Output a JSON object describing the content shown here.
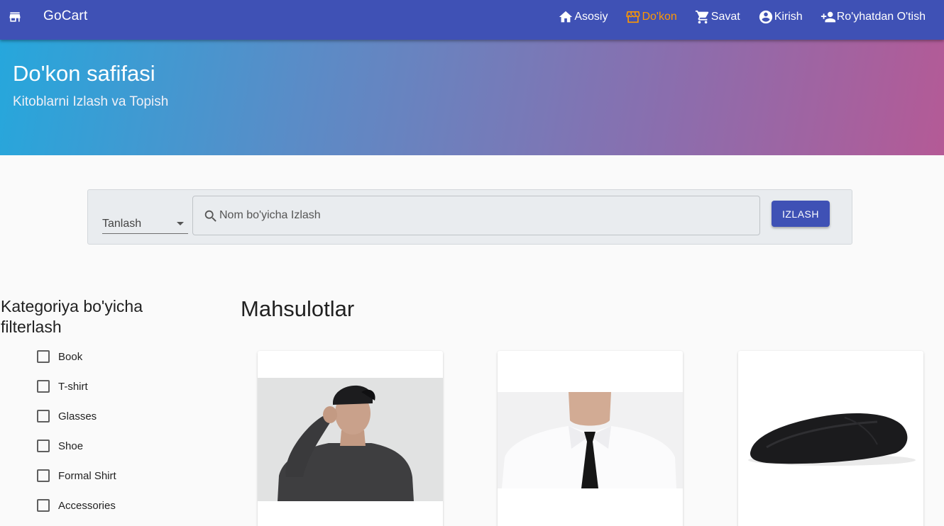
{
  "header": {
    "brand": "GoCart",
    "nav": [
      {
        "label": "Asosiy",
        "icon": "home-icon"
      },
      {
        "label": "Do'kon",
        "icon": "store-icon"
      },
      {
        "label": "Savat",
        "icon": "cart-icon"
      },
      {
        "label": "Kirish",
        "icon": "account-circle-icon"
      },
      {
        "label": "Ro'yhatdan O'tish",
        "icon": "person-add-icon"
      }
    ],
    "active_color": "#ff9800",
    "bar_color": "#3f51b5"
  },
  "hero": {
    "title": "Do'kon safifasi",
    "subtitle": "Kitoblarni Izlash va Topish"
  },
  "search": {
    "select_label": "Tanlash",
    "placeholder": "Nom bo'yicha Izlash",
    "button": "IZLASH"
  },
  "filters": {
    "title": "Kategoriya bo'yicha filterlash",
    "items": [
      {
        "label": "Book",
        "checked": false
      },
      {
        "label": "T-shirt",
        "checked": false
      },
      {
        "label": "Glasses",
        "checked": false
      },
      {
        "label": "Shoe",
        "checked": false
      },
      {
        "label": "Formal Shirt",
        "checked": false
      },
      {
        "label": "Accessories",
        "checked": false
      }
    ]
  },
  "products": {
    "title": "Mahsulotlar",
    "items": [
      {
        "image": "man-in-black-cap-photo"
      },
      {
        "image": "white-shirt-black-tie-photo"
      },
      {
        "image": "black-wireless-mouse-photo"
      }
    ]
  }
}
